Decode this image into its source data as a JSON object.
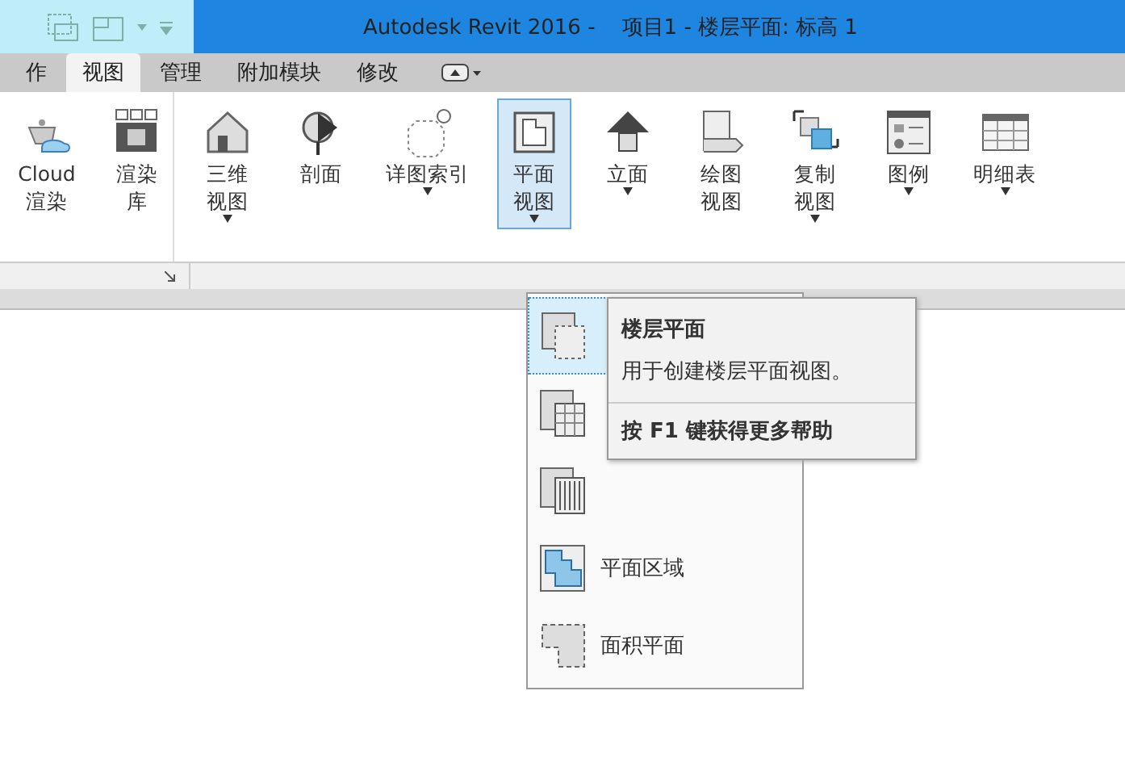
{
  "window": {
    "title": "Autodesk Revit 2016 -    项目1 - 楼层平面: 标高 1"
  },
  "tabs": [
    {
      "label": "作",
      "selected": false
    },
    {
      "label": "视图",
      "selected": true
    },
    {
      "label": "管理",
      "selected": false
    },
    {
      "label": "附加模块",
      "selected": false
    },
    {
      "label": "修改",
      "selected": false
    }
  ],
  "ribbon": {
    "groups": [
      [
        {
          "lines": [
            "Cloud",
            "渲染"
          ],
          "dropdown": false,
          "selected": false
        },
        {
          "lines": [
            "渲染",
            "库"
          ],
          "dropdown": false,
          "selected": false
        }
      ],
      [
        {
          "lines": [
            "三维",
            "视图"
          ],
          "dropdown": true,
          "selected": false
        },
        {
          "lines": [
            "剖面"
          ],
          "dropdown": false,
          "selected": false
        },
        {
          "lines": [
            "详图索引"
          ],
          "dropdown": true,
          "selected": false
        },
        {
          "lines": [
            "平面",
            "视图"
          ],
          "dropdown": true,
          "selected": true
        },
        {
          "lines": [
            "立面"
          ],
          "dropdown": true,
          "selected": false
        },
        {
          "lines": [
            "绘图",
            "视图"
          ],
          "dropdown": false,
          "selected": false
        },
        {
          "lines": [
            "复制",
            "视图"
          ],
          "dropdown": true,
          "selected": false
        },
        {
          "lines": [
            "图例"
          ],
          "dropdown": true,
          "selected": false
        },
        {
          "lines": [
            "明细表"
          ],
          "dropdown": true,
          "selected": false
        }
      ]
    ]
  },
  "menu": {
    "items": [
      {
        "selected": true
      },
      {
        "selected": false
      },
      {
        "selected": false
      },
      {
        "label": "平面区域",
        "selected": false
      },
      {
        "label": "面积平面",
        "selected": false
      }
    ]
  },
  "tooltip": {
    "title": "楼层平面",
    "description": "用于创建楼层平面视图。",
    "help": "按 **F1** 键获得更多帮助"
  }
}
